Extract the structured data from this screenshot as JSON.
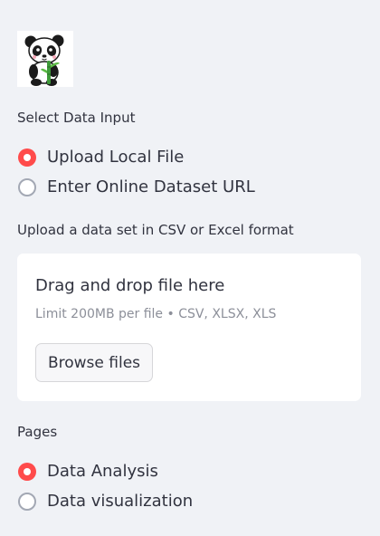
{
  "logo": {
    "icon": "panda-logo"
  },
  "data_input": {
    "label": "Select Data Input",
    "options": [
      {
        "label": "Upload Local File",
        "selected": true
      },
      {
        "label": "Enter Online Dataset URL",
        "selected": false
      }
    ]
  },
  "uploader": {
    "label": "Upload a data set in CSV or Excel format",
    "drop_text": "Drag and drop file here",
    "limit_text": "Limit 200MB per file • CSV, XLSX, XLS",
    "browse_label": "Browse files"
  },
  "pages": {
    "label": "Pages",
    "options": [
      {
        "label": "Data Analysis",
        "selected": true
      },
      {
        "label": "Data visualization",
        "selected": false
      }
    ]
  },
  "colors": {
    "background": "#f0f2f6",
    "accent": "#ff4b4b",
    "text": "#31333f",
    "muted_text": "#8c8f99",
    "card": "#ffffff"
  }
}
